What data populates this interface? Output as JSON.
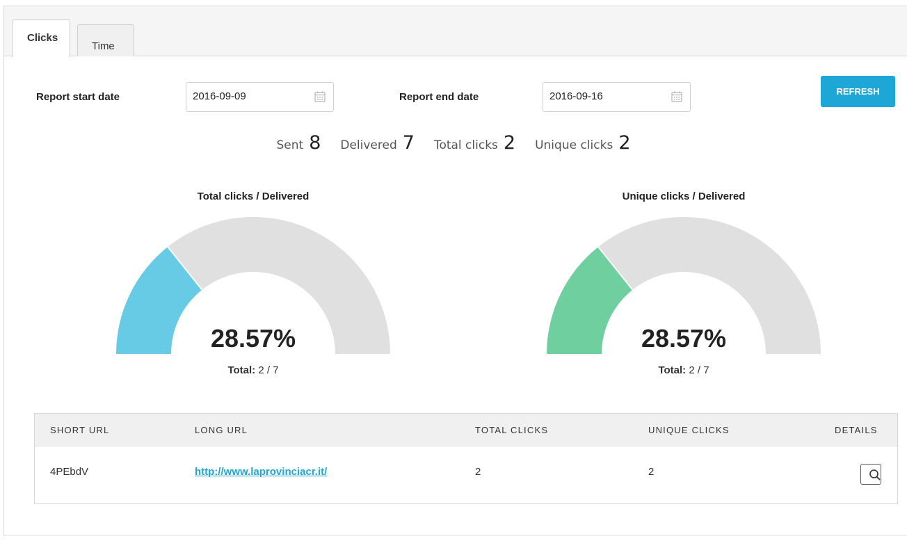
{
  "tabs": [
    {
      "label": "Clicks",
      "active": true
    },
    {
      "label": "Time",
      "active": false
    }
  ],
  "filters": {
    "start_label": "Report start date",
    "start_value": "2016-09-09",
    "end_label": "Report end date",
    "end_value": "2016-09-16",
    "refresh_label": "REFRESH"
  },
  "stats": {
    "sent_label": "Sent",
    "sent_value": "8",
    "delivered_label": "Delivered",
    "delivered_value": "7",
    "total_clicks_label": "Total clicks",
    "total_clicks_value": "2",
    "unique_clicks_label": "Unique clicks",
    "unique_clicks_value": "2"
  },
  "gauges": [
    {
      "title": "Total clicks / Delivered",
      "percent_text": "28.57%",
      "fraction": 0.2857,
      "total_label": "Total:",
      "total_value": "2 / 7",
      "color": "#68cbe6",
      "track": "#e0e0e0"
    },
    {
      "title": "Unique clicks / Delivered",
      "percent_text": "28.57%",
      "fraction": 0.2857,
      "total_label": "Total:",
      "total_value": "2 / 7",
      "color": "#70cf9f",
      "track": "#e0e0e0"
    }
  ],
  "table": {
    "headers": [
      "SHORT URL",
      "LONG URL",
      "TOTAL CLICKS",
      "UNIQUE CLICKS",
      "DETAILS"
    ],
    "rows": [
      {
        "short_url": "4PEbdV",
        "long_url": "http://www.laprovinciacr.it/",
        "total_clicks": "2",
        "unique_clicks": "2",
        "details_icon": "search-icon"
      }
    ]
  },
  "colors": {
    "accent": "#1ea7d6"
  }
}
